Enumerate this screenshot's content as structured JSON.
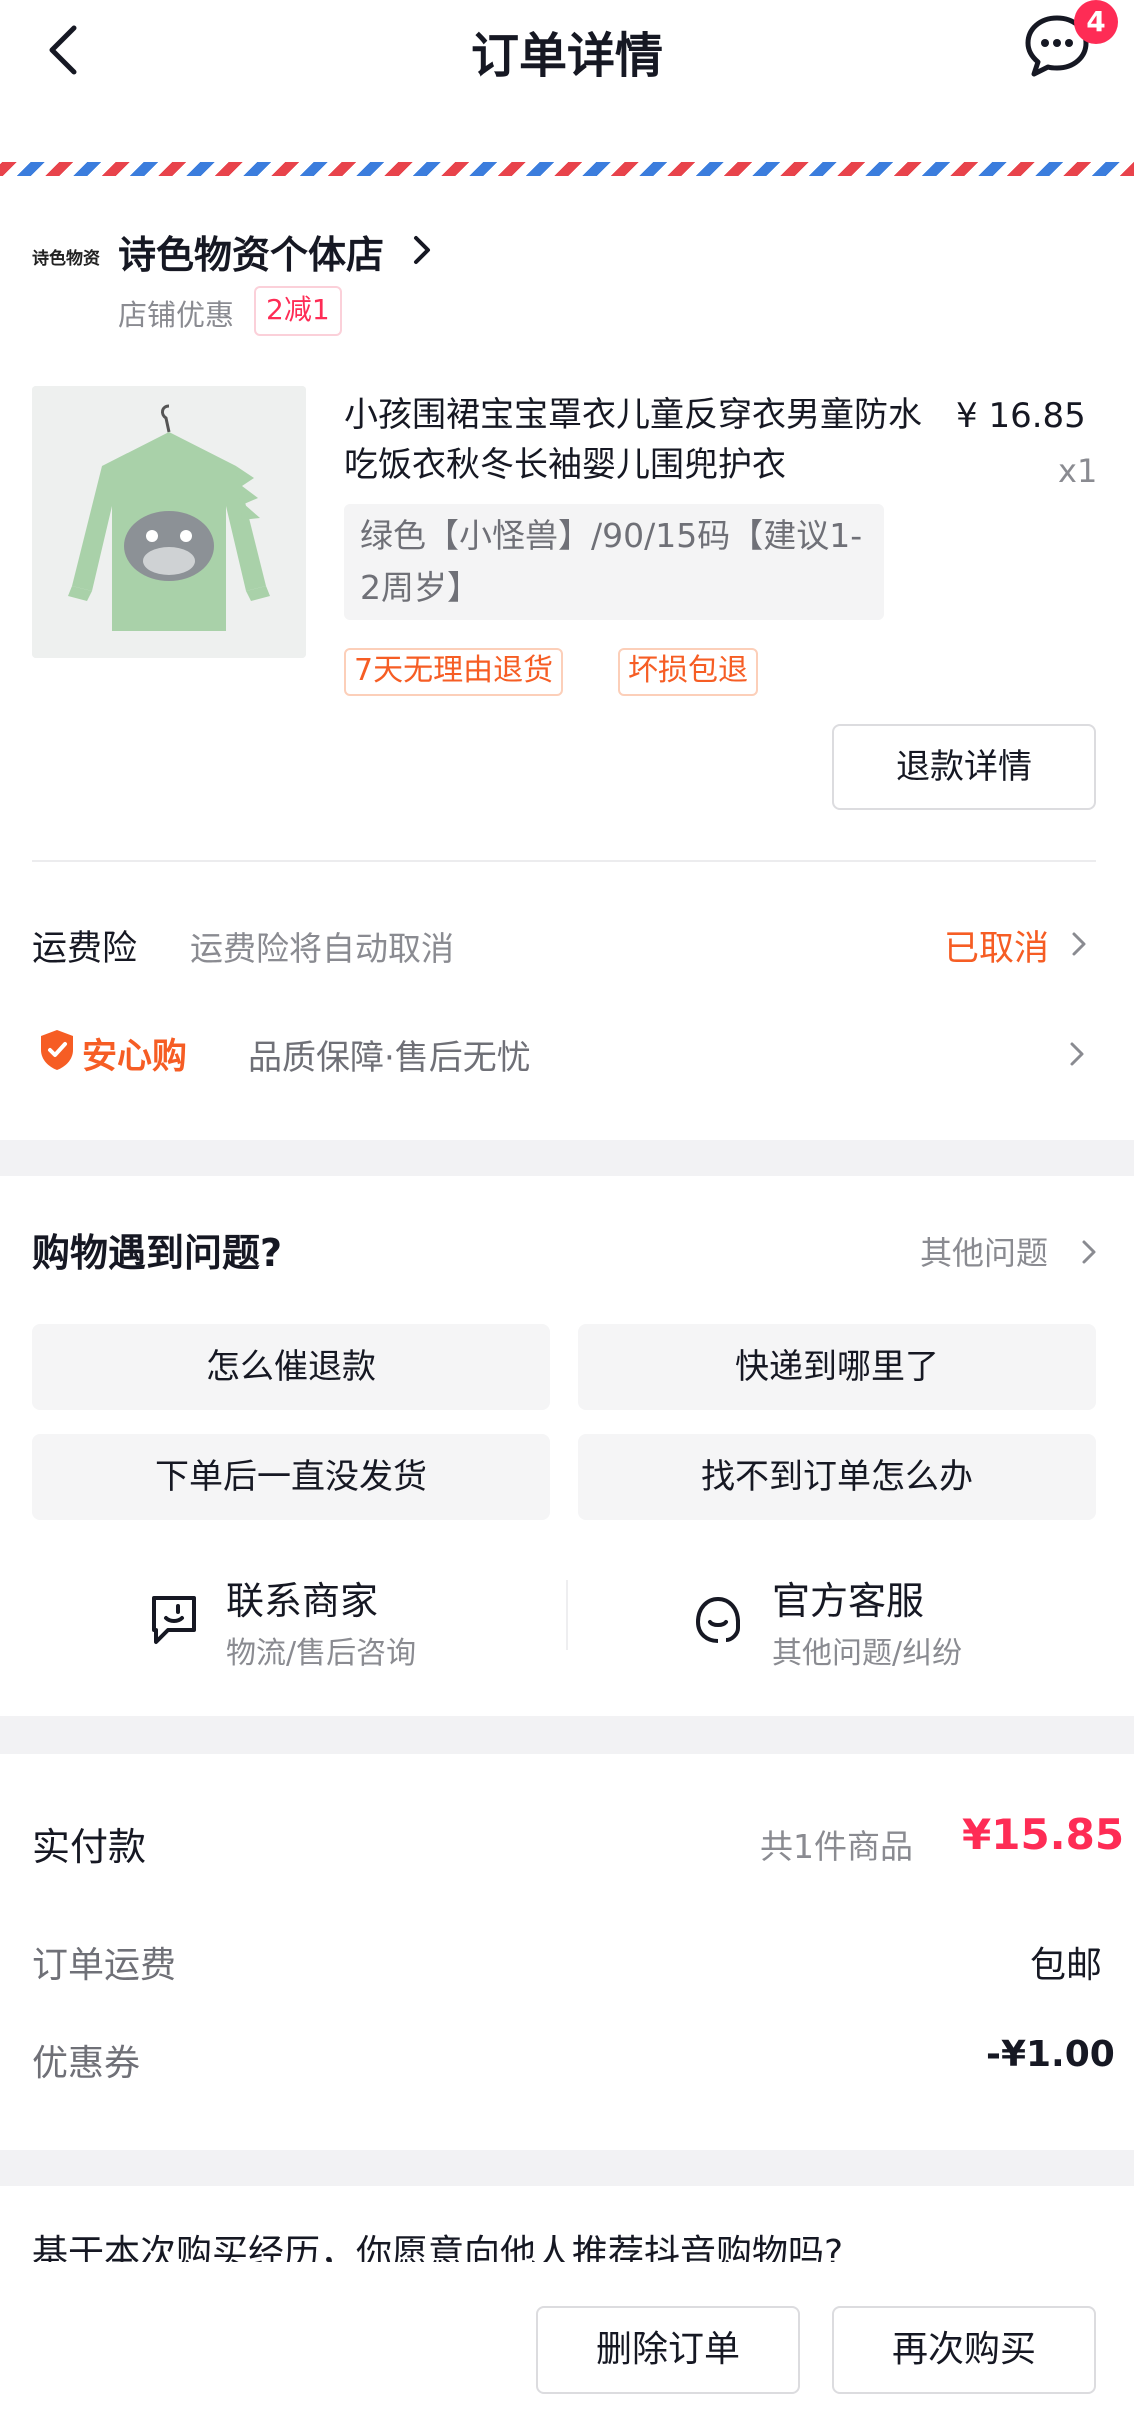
{
  "header": {
    "title": "订单详情",
    "message_badge": "4"
  },
  "shop": {
    "logo_text": "诗色物资",
    "name": "诗色物资个体店",
    "promo_label": "店铺优惠",
    "promo_tag": "2减1"
  },
  "product": {
    "title": "小孩围裙宝宝罩衣儿童反穿衣男童防水吃饭衣秋冬长袖婴儿围兜护衣",
    "price": "¥ 16.85",
    "quantity": "x1",
    "spec": "绿色【小怪兽】/90/15码【建议1-2周岁】",
    "tags": [
      "7天无理由退货",
      "坏损包退"
    ],
    "refund_button": "退款详情"
  },
  "insurance": {
    "label": "运费险",
    "description": "运费险将自动取消",
    "status": "已取消"
  },
  "anxin": {
    "logo_text": "安心购",
    "description": "品质保障·售后无忧"
  },
  "help": {
    "title": "购物遇到问题?",
    "other_link": "其他问题",
    "questions": [
      "怎么催退款",
      "快递到哪里了",
      "下单后一直没发货",
      "找不到订单怎么办"
    ],
    "contact_merchant": {
      "title": "联系商家",
      "subtitle": "物流/售后咨询"
    },
    "official_service": {
      "title": "官方客服",
      "subtitle": "其他问题/纠纷"
    }
  },
  "payment": {
    "label": "实付款",
    "item_count": "共1件商品",
    "amount": "¥15.85",
    "shipping_label": "订单运费",
    "shipping_value": "包邮",
    "coupon_label": "优惠券",
    "coupon_value": "-¥1.00"
  },
  "survey": {
    "text": "基于本次购买经历，你愿意向他人推荐抖音购物吗?"
  },
  "actions": {
    "delete": "删除订单",
    "rebuy": "再次购买"
  },
  "colors": {
    "accent_red": "#fe2c55",
    "accent_orange": "#f65d24"
  }
}
